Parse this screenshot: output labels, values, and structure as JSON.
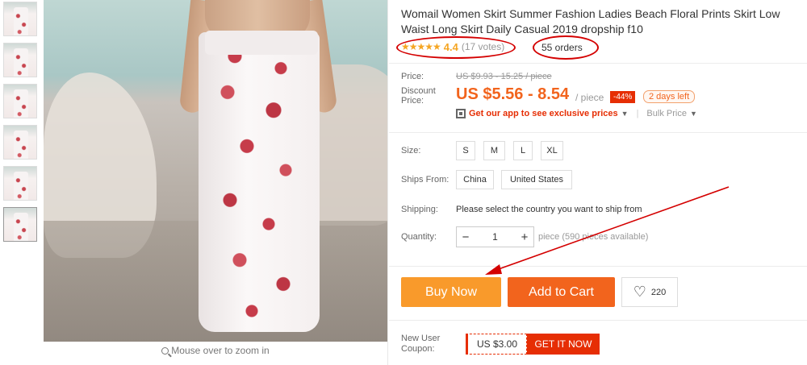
{
  "product": {
    "title": "Womail Women Skirt Summer Fashion Ladies Beach Floral Prints Skirt Low Waist Long Skirt Daily Casual 2019 dropship f10",
    "stars": "★★★★★",
    "rating": "4.4",
    "votes": "(17 votes)",
    "orders": "55 orders"
  },
  "gallery": {
    "thumbnails": [
      "thumb-1",
      "thumb-2",
      "thumb-3",
      "thumb-4",
      "thumb-5",
      "thumb-6"
    ],
    "zoom_hint": "Mouse over to zoom in"
  },
  "pricing": {
    "price_label": "Price:",
    "original_price": "US $9.93 - 15.25 / piece",
    "discount_label_1": "Discount",
    "discount_label_2": "Price:",
    "discount_price": "US $5.56 - 8.54",
    "per_unit": "/ piece",
    "discount_pct": "-44%",
    "days_left": "2 days left",
    "app_promo": "Get our app to see exclusive prices",
    "bulk_price": "Bulk Price"
  },
  "options": {
    "size_label": "Size:",
    "sizes": [
      "S",
      "M",
      "L",
      "XL"
    ],
    "ships_from_label": "Ships From:",
    "ships_from": [
      "China",
      "United States"
    ],
    "shipping_label": "Shipping:",
    "shipping_text": "Please select the country you want to ship from",
    "quantity_label": "Quantity:",
    "quantity_minus": "−",
    "quantity_value": "1",
    "quantity_plus": "+",
    "quantity_note": "piece (590 pieces available)"
  },
  "actions": {
    "buy_now": "Buy Now",
    "add_to_cart": "Add to Cart",
    "wishlist_count": "220"
  },
  "coupon": {
    "label_1": "New User",
    "label_2": "Coupon:",
    "amount": "US $3.00",
    "get": "GET IT NOW"
  },
  "colors": {
    "accent_orange": "#f2641d",
    "buy_now": "#f99a2b",
    "annotation_red": "#d40000",
    "star": "#f5a623"
  }
}
